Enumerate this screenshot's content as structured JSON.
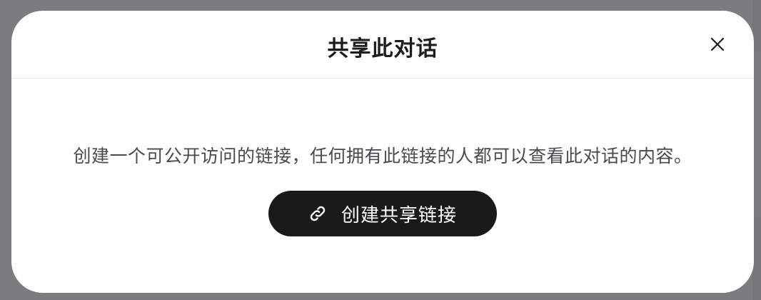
{
  "dialog": {
    "title": "共享此对话",
    "close_icon": "close-icon",
    "description": "创建一个可公开访问的链接，任何拥有此链接的人都可以查看此对话的内容。",
    "button": {
      "label": "创建共享链接",
      "icon": "link-icon"
    }
  },
  "colors": {
    "backdrop": "#7b7c80",
    "dialog_background": "#ffffff",
    "button_background": "#1a1a1a",
    "button_text": "#ffffff",
    "title_text": "#1c1c1e",
    "body_text": "#4a4a4e"
  }
}
